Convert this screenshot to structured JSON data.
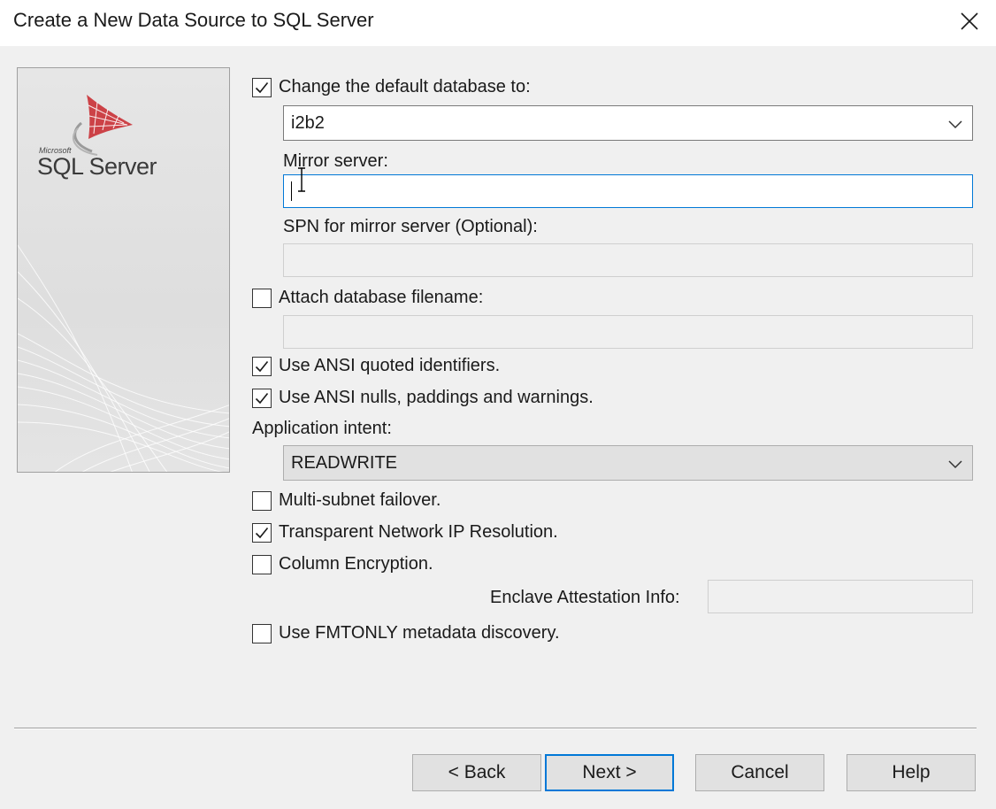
{
  "window": {
    "title": "Create a New Data Source to SQL Server"
  },
  "banner": {
    "brand_small": "Microsoft",
    "brand": "SQL Server"
  },
  "options": {
    "change_default_db": {
      "label": "Change the default database to:",
      "checked": true
    },
    "database_value": "i2b2",
    "mirror_server": {
      "label": "Mirror server:",
      "value": ""
    },
    "spn_mirror": {
      "label": "SPN for mirror server (Optional):",
      "value": ""
    },
    "attach_db": {
      "label": "Attach database filename:",
      "checked": false
    },
    "ansi_quoted": {
      "label": "Use ANSI quoted identifiers.",
      "checked": true
    },
    "ansi_nulls": {
      "label": "Use ANSI nulls, paddings and warnings.",
      "checked": true
    },
    "application_intent": {
      "label": "Application intent:",
      "value": "READWRITE"
    },
    "multi_subnet": {
      "label": "Multi-subnet failover.",
      "checked": false
    },
    "transparent_ip": {
      "label": "Transparent Network IP Resolution.",
      "checked": true
    },
    "column_encryption": {
      "label": "Column Encryption.",
      "checked": false
    },
    "enclave": {
      "label": "Enclave Attestation Info:",
      "value": ""
    },
    "fmtonly": {
      "label": "Use FMTONLY metadata discovery.",
      "checked": false
    }
  },
  "buttons": {
    "back": "< Back",
    "next": "Next >",
    "cancel": "Cancel",
    "help": "Help"
  },
  "colors": {
    "accent": "#0078d7",
    "logo_red": "#c8262b"
  },
  "icons": {
    "close": "close-icon",
    "dropdown": "chevron-down-icon",
    "check": "checkmark-icon"
  }
}
